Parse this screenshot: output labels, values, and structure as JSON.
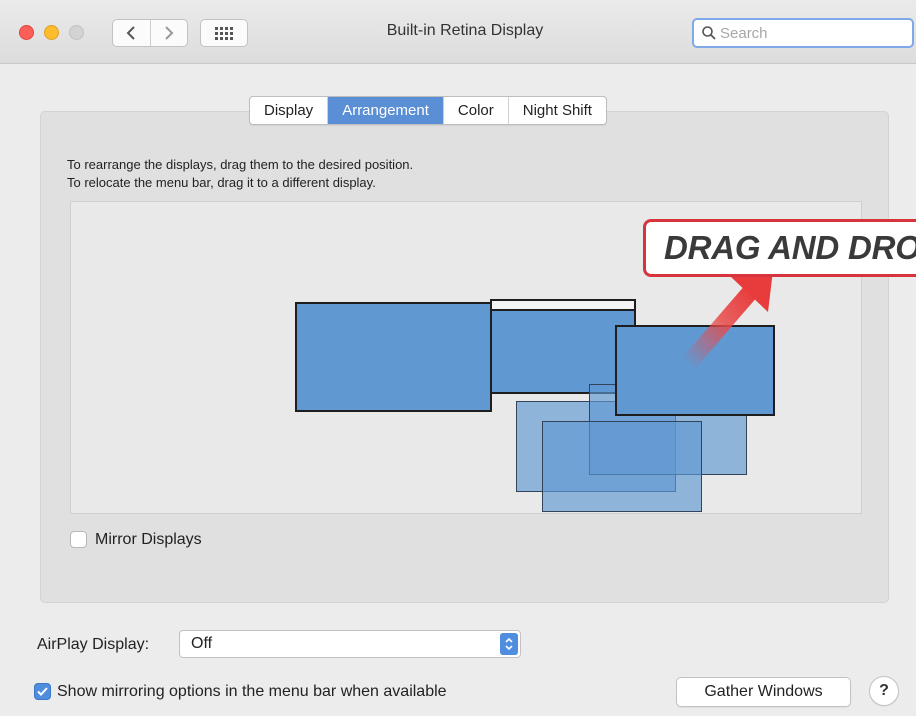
{
  "window": {
    "title": "Built-in Retina Display",
    "search_placeholder": "Search"
  },
  "tabs": [
    {
      "label": "Display",
      "active": false
    },
    {
      "label": "Arrangement",
      "active": true
    },
    {
      "label": "Color",
      "active": false
    },
    {
      "label": "Night Shift",
      "active": false
    }
  ],
  "arrangement": {
    "instruction_1": "To rearrange the displays, drag them to the desired position.",
    "instruction_2": "To relocate the menu bar, drag it to a different display."
  },
  "callout": {
    "text": "DRAG AND DROP",
    "color": "#d8343d"
  },
  "mirror_displays": {
    "label": "Mirror Displays",
    "checked": false
  },
  "airplay": {
    "label": "AirPlay Display:",
    "value": "Off"
  },
  "show_mirroring": {
    "label": "Show mirroring options in the menu bar when available",
    "checked": true
  },
  "buttons": {
    "gather": "Gather Windows",
    "help": "?"
  },
  "colors": {
    "accent": "#5a8ed5",
    "display_fill": "#6098d2"
  },
  "icons": {
    "back": "chevron-left-icon",
    "forward": "chevron-right-icon",
    "grid": "grid-icon",
    "search": "search-icon",
    "arrow": "arrow-icon"
  }
}
